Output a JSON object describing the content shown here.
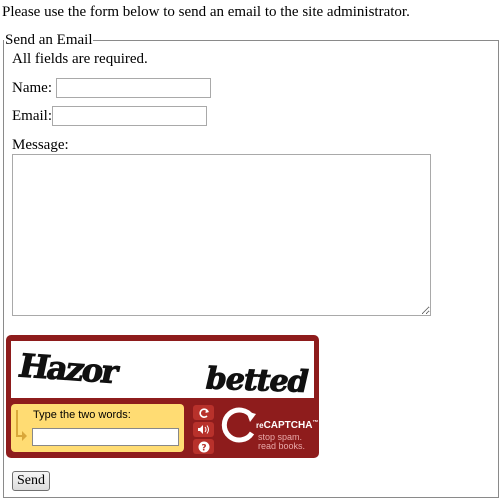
{
  "intro_text": "Please use the form below to send an email to the site administrator.",
  "form": {
    "legend": "Send an Email",
    "required_note": "All fields are required.",
    "name_label": "Name:",
    "name_value": "",
    "email_label": "Email:",
    "email_value": "",
    "message_label": "Message:",
    "message_value": "",
    "send_label": "Send"
  },
  "captcha": {
    "words": [
      "Hazor",
      "betted"
    ],
    "prompt": "Type the two words:",
    "response_value": "",
    "brand_prefix": "re",
    "brand_name": "CAPTCHA",
    "slogan_line1": "stop spam.",
    "slogan_line2": "read books.",
    "buttons": [
      "refresh-icon",
      "audio-icon",
      "help-icon"
    ],
    "colors": {
      "frame": "#8e1c1c",
      "input_box": "#ffdc73",
      "button": "#b8312b"
    }
  }
}
